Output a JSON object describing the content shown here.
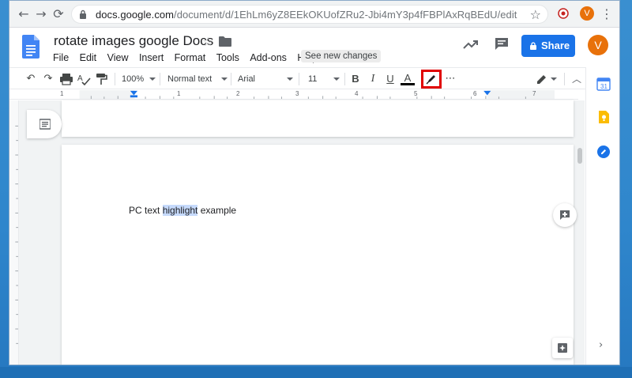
{
  "browser": {
    "url_host": "docs.google.com",
    "url_path": "/document/d/1EhLm6yZ8EEkOKUofZRu2-Jbi4mY3p4fFBPlAxRqBEdU/edit",
    "profile_initial": "V",
    "icons": [
      "back-arrow-icon",
      "forward-arrow-icon",
      "reload-icon",
      "lock-icon",
      "bookmark-star-icon",
      "extension-icon",
      "kebab-menu-icon"
    ]
  },
  "docs": {
    "title": "rotate images google Docs",
    "menu": [
      "File",
      "Edit",
      "View",
      "Insert",
      "Format",
      "Tools",
      "Add-ons",
      "Help"
    ],
    "see_new_changes": "See new changes",
    "share_label": "Share",
    "avatar_initial": "V",
    "accent_color": "#1a73e8",
    "avatar_color": "#e8710a"
  },
  "toolbar": {
    "zoom": "100%",
    "style": "Normal text",
    "font": "Arial",
    "font_size": "11",
    "bold": "B",
    "italic": "I",
    "underline": "U",
    "text_color": "A",
    "more": "⋯",
    "highlight_marker_color": "#e00000"
  },
  "ruler": {
    "numbers": [
      "1",
      "1",
      "2",
      "3",
      "4",
      "5",
      "6",
      "7"
    ]
  },
  "document": {
    "text_before": "PC text ",
    "text_highlighted": "highlight",
    "text_after": " example",
    "highlight_color": "#c6dafc"
  }
}
